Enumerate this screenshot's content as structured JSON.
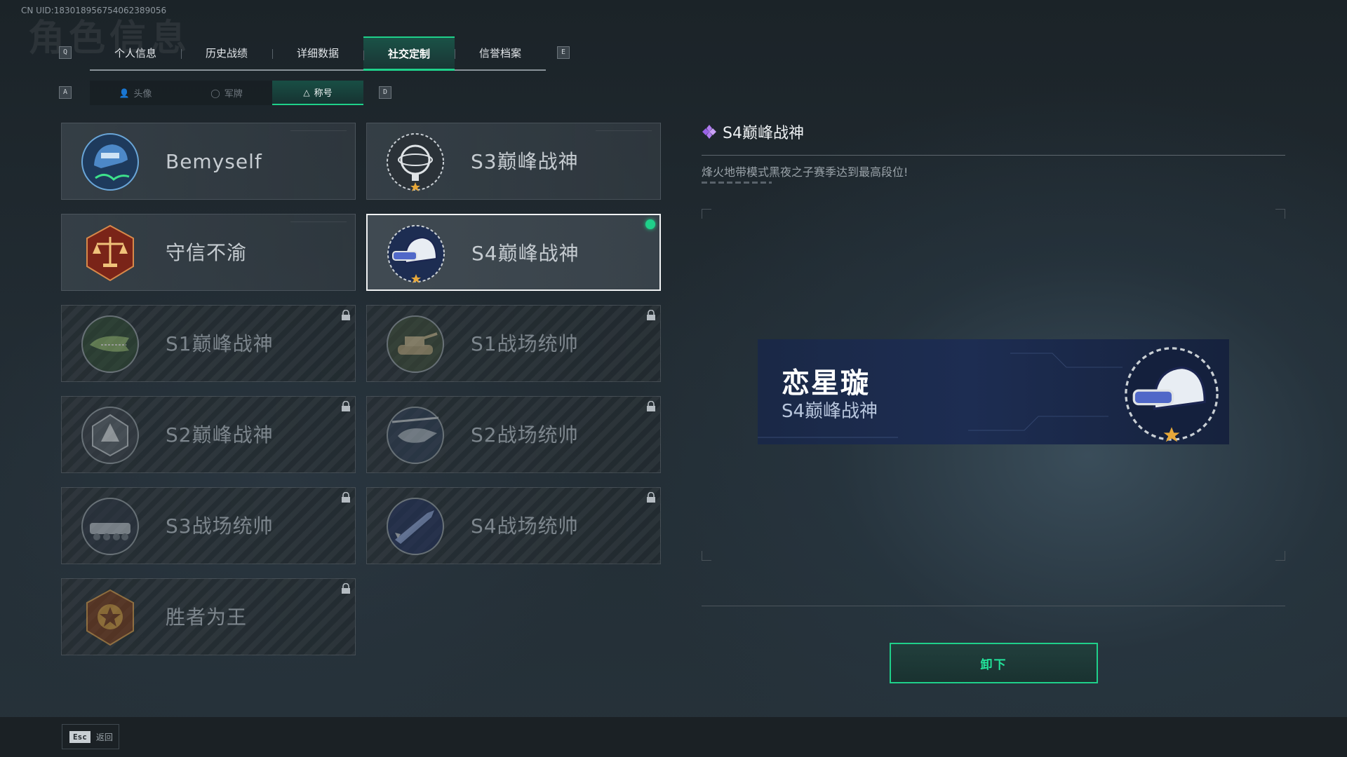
{
  "uid_text": "CN UID:18301895675406238905​6",
  "background_heading": "角色信息",
  "tabs": {
    "prev_key": "Q",
    "next_key": "E",
    "items": [
      {
        "label": "个人信息"
      },
      {
        "label": "历史战绩"
      },
      {
        "label": "详细数据"
      },
      {
        "label": "社交定制"
      },
      {
        "label": "信誉档案"
      }
    ],
    "active_index": 3
  },
  "subtabs": {
    "prev_key": "A",
    "next_key": "D",
    "items": [
      {
        "label": "头像",
        "icon": "person-icon"
      },
      {
        "label": "军牌",
        "icon": "dogtag-icon"
      },
      {
        "label": "称号",
        "icon": "title-triangle-icon"
      }
    ],
    "active_index": 2
  },
  "cards": [
    {
      "title": "Bemyself",
      "badge": "helmet-signature-icon",
      "locked": false,
      "selected": false
    },
    {
      "title": "S3巅峰战神",
      "badge": "armillary-sphere-icon",
      "locked": false,
      "selected": false
    },
    {
      "title": "守信不渝",
      "badge": "scales-icon",
      "locked": false,
      "selected": false
    },
    {
      "title": "S4巅峰战神",
      "badge": "night-vision-helmet-icon",
      "locked": false,
      "selected": true
    },
    {
      "title": "S1巅峰战神",
      "badge": "crocodile-icon",
      "locked": true,
      "selected": false
    },
    {
      "title": "S1战场统帅",
      "badge": "tank-icon",
      "locked": true,
      "selected": false
    },
    {
      "title": "S2巅峰战神",
      "badge": "gas-mask-icon",
      "locked": true,
      "selected": false
    },
    {
      "title": "S2战场统帅",
      "badge": "helicopter-icon",
      "locked": true,
      "selected": false
    },
    {
      "title": "S3战场统帅",
      "badge": "armored-vehicle-icon",
      "locked": true,
      "selected": false
    },
    {
      "title": "S4战场统帅",
      "badge": "missile-icon",
      "locked": true,
      "selected": false
    },
    {
      "title": "胜者为王",
      "badge": "medal-icon",
      "locked": true,
      "selected": false
    }
  ],
  "detail": {
    "title": "S4巅峰战神",
    "description": "烽火地带模式黑夜之子赛季达到最高段位!",
    "preview_name": "恋星璇",
    "preview_title": "S4巅峰战神",
    "action_label": "卸下"
  },
  "footer": {
    "esc_key": "Esc",
    "esc_label": "返回"
  },
  "colors": {
    "accent": "#1fd08a",
    "preview_bg": "#1d2d52",
    "diamond": "#b07cf0"
  }
}
